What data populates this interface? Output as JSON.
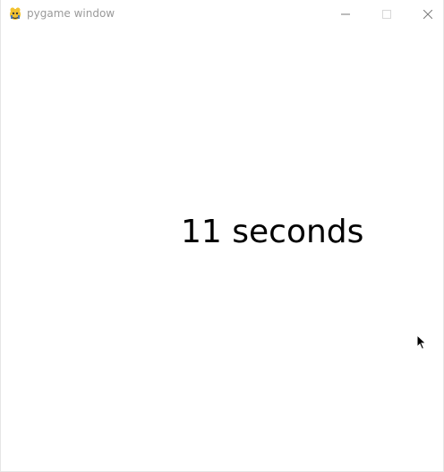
{
  "window": {
    "title": "pygame window",
    "buttons": {
      "minimize": "minimize-icon",
      "maximize": "maximize-icon",
      "close": "close-icon"
    }
  },
  "canvas": {
    "timer_text": "11 seconds"
  },
  "colors": {
    "background": "#ffffff",
    "text": "#000000",
    "title_text": "#9a9a9a"
  }
}
